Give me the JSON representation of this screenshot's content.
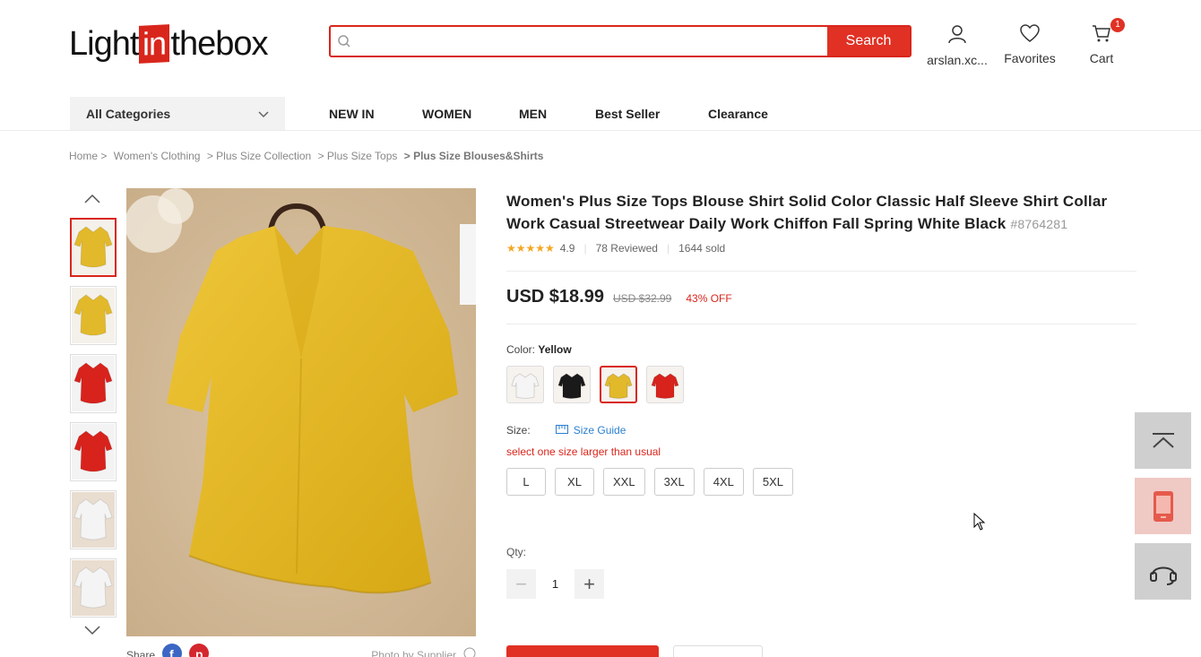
{
  "header": {
    "logo_pre": "Light",
    "logo_in": "in",
    "logo_post": "thebox",
    "search_placeholder": "",
    "search_button": "Search",
    "account_label": "arslan.xc...",
    "favorites_label": "Favorites",
    "cart_label": "Cart",
    "cart_count": "1"
  },
  "nav": {
    "all_categories": "All Categories",
    "items": [
      "NEW IN",
      "WOMEN",
      "MEN",
      "Best Seller",
      "Clearance"
    ]
  },
  "breadcrumb": [
    "Home >",
    "Women's Clothing",
    "> Plus Size Collection",
    "> Plus Size Tops",
    "> Plus Size Blouses&Shirts"
  ],
  "gallery": {
    "thumbnail_colors": [
      "#e2b92a",
      "#e2b92a",
      "#d8221c",
      "#d8221c",
      "#f4f4f4",
      "#f4f4f4"
    ],
    "active_index": 0,
    "share_label": "Share",
    "photo_credit": "Photo by Supplier"
  },
  "product": {
    "title": "Women's Plus Size Tops Blouse Shirt Solid Color Classic Half Sleeve Shirt Collar Work Casual Streetwear Daily Work Chiffon Fall Spring White Black",
    "sku": "#8764281",
    "rating": "4.9",
    "stars": "★★★★★",
    "reviews": "78 Reviewed",
    "sold": "1644 sold",
    "price": "USD $18.99",
    "original_price": "USD $32.99",
    "discount": "43% OFF",
    "color_label": "Color:",
    "color_selected": "Yellow",
    "swatches": [
      "#f5f5f5",
      "#1a1a1a",
      "#e2b92a",
      "#d8221c"
    ],
    "active_swatch": 2,
    "size_label": "Size:",
    "size_guide": "Size Guide",
    "size_note": "select one size larger than usual",
    "sizes": [
      "L",
      "XL",
      "XXL",
      "3XL",
      "4XL",
      "5XL"
    ],
    "qty_label": "Qty:",
    "qty_value": "1"
  },
  "colors": {
    "accent": "#e03124",
    "link": "#2b7fd0",
    "star": "#f5a623"
  }
}
